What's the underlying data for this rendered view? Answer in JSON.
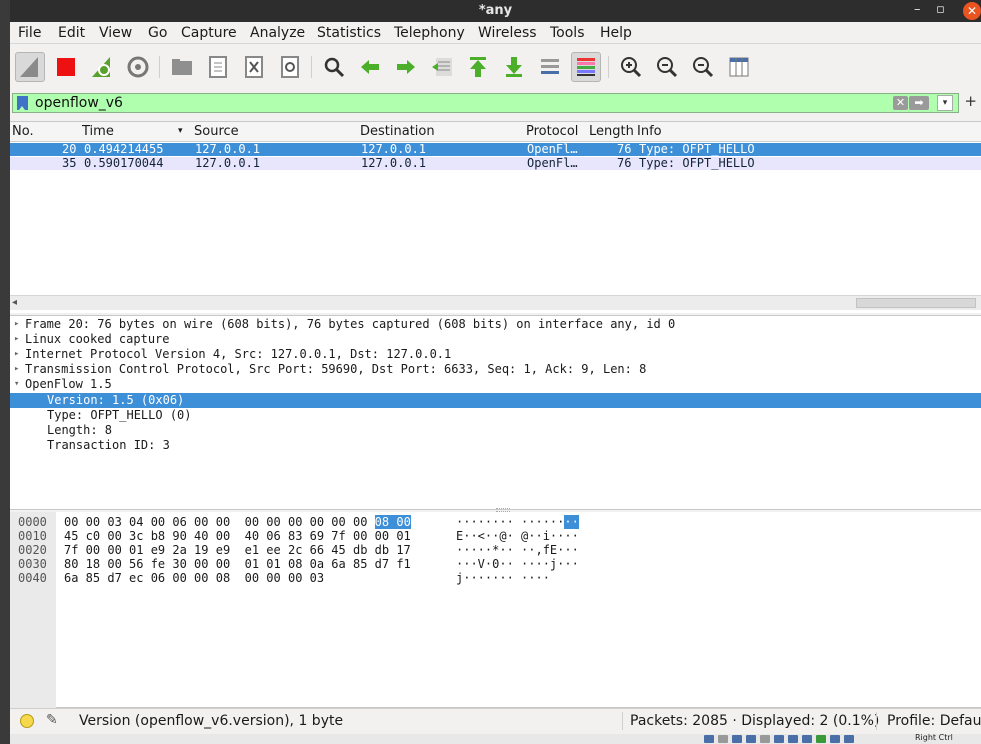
{
  "window": {
    "title": "*any",
    "minimize": "–",
    "maximize": "▫",
    "close": "✕"
  },
  "menu": [
    "File",
    "Edit",
    "View",
    "Go",
    "Capture",
    "Analyze",
    "Statistics",
    "Telephony",
    "Wireless",
    "Tools",
    "Help"
  ],
  "filter": {
    "value": "openflow_v6",
    "clear": "✕",
    "apply": "➡",
    "dropdown": "▾",
    "plus": "+"
  },
  "packet_list": {
    "columns": [
      "No.",
      "Time",
      "Source",
      "Destination",
      "Protocol",
      "Length",
      "Info"
    ],
    "sort_indicator": "▾",
    "rows": [
      {
        "no": "20",
        "time": "0.494214455",
        "source": "127.0.0.1",
        "destination": "127.0.0.1",
        "protocol": "OpenFl…",
        "length": "76",
        "info": "Type: OFPT_HELLO"
      },
      {
        "no": "35",
        "time": "0.590170044",
        "source": "127.0.0.1",
        "destination": "127.0.0.1",
        "protocol": "OpenFl…",
        "length": "76",
        "info": "Type: OFPT_HELLO"
      }
    ]
  },
  "details": [
    {
      "tri": "▸",
      "text": "Frame 20: 76 bytes on wire (608 bits), 76 bytes captured (608 bits) on interface any, id 0",
      "indent": 0
    },
    {
      "tri": "▸",
      "text": "Linux cooked capture",
      "indent": 0
    },
    {
      "tri": "▸",
      "text": "Internet Protocol Version 4, Src: 127.0.0.1, Dst: 127.0.0.1",
      "indent": 0
    },
    {
      "tri": "▸",
      "text": "Transmission Control Protocol, Src Port: 59690, Dst Port: 6633, Seq: 1, Ack: 9, Len: 8",
      "indent": 0
    },
    {
      "tri": "▾",
      "text": "OpenFlow 1.5",
      "indent": 0
    },
    {
      "tri": "",
      "text": "Version: 1.5 (0x06)",
      "indent": 1
    },
    {
      "tri": "",
      "text": "Type: OFPT_HELLO (0)",
      "indent": 1
    },
    {
      "tri": "",
      "text": "Length: 8",
      "indent": 1
    },
    {
      "tri": "",
      "text": "Transaction ID: 3",
      "indent": 1
    }
  ],
  "bytes": [
    {
      "offset": "0000",
      "hex_a": "00 00 03 04 00 06 00 00  00 00 00 00 00 00 ",
      "hex_hl": "08 00",
      "ascii_a": "········ ······",
      "ascii_hl": "··"
    },
    {
      "offset": "0010",
      "hex_a": "45 c0 00 3c b8 90 40 00  40 06 83 69 7f 00 00 01",
      "hex_hl": "",
      "ascii_a": "E··<··@· @··i····",
      "ascii_hl": ""
    },
    {
      "offset": "0020",
      "hex_a": "7f 00 00 01 e9 2a 19 e9  e1 ee 2c 66 45 db db 17",
      "hex_hl": "",
      "ascii_a": "·····*·· ··,fE···",
      "ascii_hl": ""
    },
    {
      "offset": "0030",
      "hex_a": "80 18 00 56 fe 30 00 00  01 01 08 0a 6a 85 d7 f1",
      "hex_hl": "",
      "ascii_a": "···V·0·· ····j···",
      "ascii_hl": ""
    },
    {
      "offset": "0040",
      "hex_a": "6a 85 d7 ec 06 00 00 08  00 00 00 03",
      "hex_hl": "",
      "ascii_a": "j······· ····",
      "ascii_hl": ""
    }
  ],
  "status": {
    "message": "Version (openflow_v6.version), 1 byte",
    "packets": "Packets: 2085 · Displayed: 2 (0.1%)",
    "profile": "Profile: Default"
  },
  "tray": {
    "right_ctrl": "Right Ctrl"
  },
  "colors": {
    "selected": "#3d8fd8",
    "filter_ok": "#afffaf",
    "other_row": "#e8e6fd"
  }
}
